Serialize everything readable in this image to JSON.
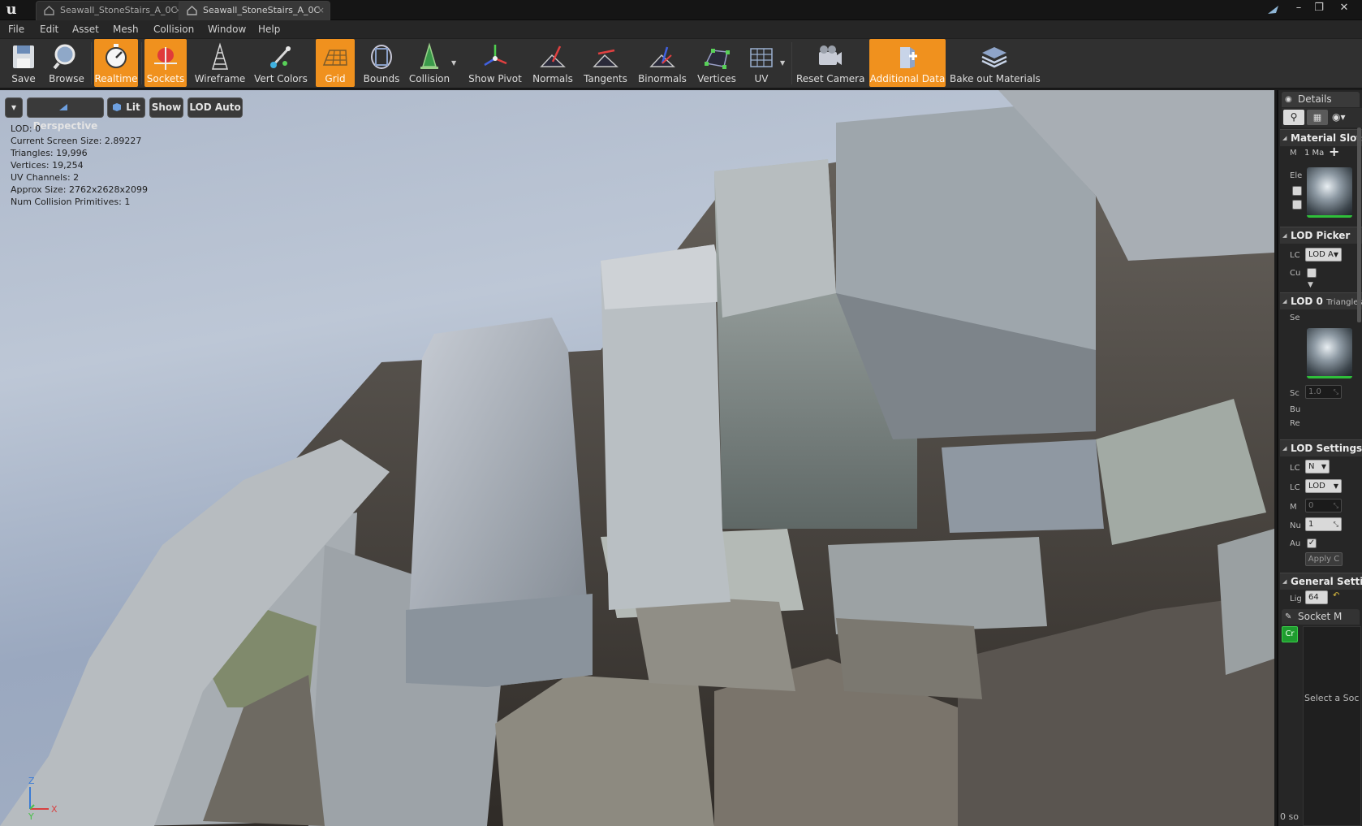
{
  "window": {
    "tabs": [
      {
        "label": "Seawall_StoneStairs_A_0C",
        "close": "×"
      },
      {
        "label": "Seawall_StoneStairs_A_0C",
        "close": "×"
      }
    ],
    "controls": {
      "minimize": "–",
      "restore": "❐",
      "close": "✕"
    }
  },
  "menu": [
    "File",
    "Edit",
    "Asset",
    "Mesh",
    "Collision",
    "Window",
    "Help"
  ],
  "toolbar": {
    "buttons": [
      {
        "label": "Save",
        "icon": "save-icon",
        "on": false
      },
      {
        "label": "Browse",
        "icon": "browse-icon",
        "on": false
      },
      {
        "label": "Realtime",
        "icon": "realtime-icon",
        "on": true
      },
      {
        "label": "Sockets",
        "icon": "sockets-icon",
        "on": true
      },
      {
        "label": "Wireframe",
        "icon": "wireframe-icon",
        "on": false
      },
      {
        "label": "Vert Colors",
        "icon": "vert-colors-icon",
        "on": false
      },
      {
        "label": "Grid",
        "icon": "grid-icon",
        "on": true
      },
      {
        "label": "Bounds",
        "icon": "bounds-icon",
        "on": false
      },
      {
        "label": "Collision",
        "icon": "collision-icon",
        "on": false
      },
      {
        "label": "Show Pivot",
        "icon": "pivot-icon",
        "on": false
      },
      {
        "label": "Normals",
        "icon": "normals-icon",
        "on": false
      },
      {
        "label": "Tangents",
        "icon": "tangents-icon",
        "on": false
      },
      {
        "label": "Binormals",
        "icon": "binormals-icon",
        "on": false
      },
      {
        "label": "Vertices",
        "icon": "vertices-icon",
        "on": false
      },
      {
        "label": "UV",
        "icon": "uv-icon",
        "on": false
      },
      {
        "label": "Reset Camera",
        "icon": "camera-icon",
        "on": false
      },
      {
        "label": "Additional Data",
        "icon": "additional-data-icon",
        "on": true
      },
      {
        "label": "Bake out Materials",
        "icon": "bake-materials-icon",
        "on": false
      }
    ],
    "accent": "#f0911e"
  },
  "viewport": {
    "buttons": {
      "perspective": "Perspective",
      "lit": "Lit",
      "show": "Show",
      "lod": "LOD Auto"
    },
    "stats": [
      "LOD:  0",
      "Current Screen Size:  2.89227",
      "Triangles:  19,996",
      "Vertices:  19,254",
      "UV Channels:  2",
      "Approx Size: 2762x2628x2099",
      "Num Collision Primitives:  1"
    ],
    "axis": {
      "z": "Z",
      "y": "Y",
      "x": "X"
    }
  },
  "details": {
    "tab": "Details",
    "material_slots": {
      "title": "Material Slots",
      "m_label": "M",
      "m_value": "1 Ma",
      "element_label": "Ele"
    },
    "lod_picker": {
      "title": "LOD Picker",
      "lod_label": "LC",
      "lod_value": "LOD A",
      "custom_label": "Cu"
    },
    "lod0": {
      "title": "LOD 0",
      "suffix": "Triangles",
      "section_label": "Se",
      "screen_label": "Sc",
      "screen_value": "1.0",
      "build_label": "Bu",
      "reduction_label": "Re"
    },
    "lod_settings": {
      "title": "LOD Settings",
      "group_label": "LC",
      "group_value": "N",
      "import_label": "LC",
      "import_value": "LOD",
      "min_label": "M",
      "min_value": "0",
      "num_label": "Nu",
      "num_value": "1",
      "auto_label": "Au",
      "apply_label": "Apply C"
    },
    "general": {
      "title": "General Settings",
      "light_label": "Lig",
      "light_value": "64"
    },
    "socket_tab": "Socket M",
    "create_socket": "Cr",
    "select_socket": "Select a Soc",
    "socket_count": "0 so"
  }
}
